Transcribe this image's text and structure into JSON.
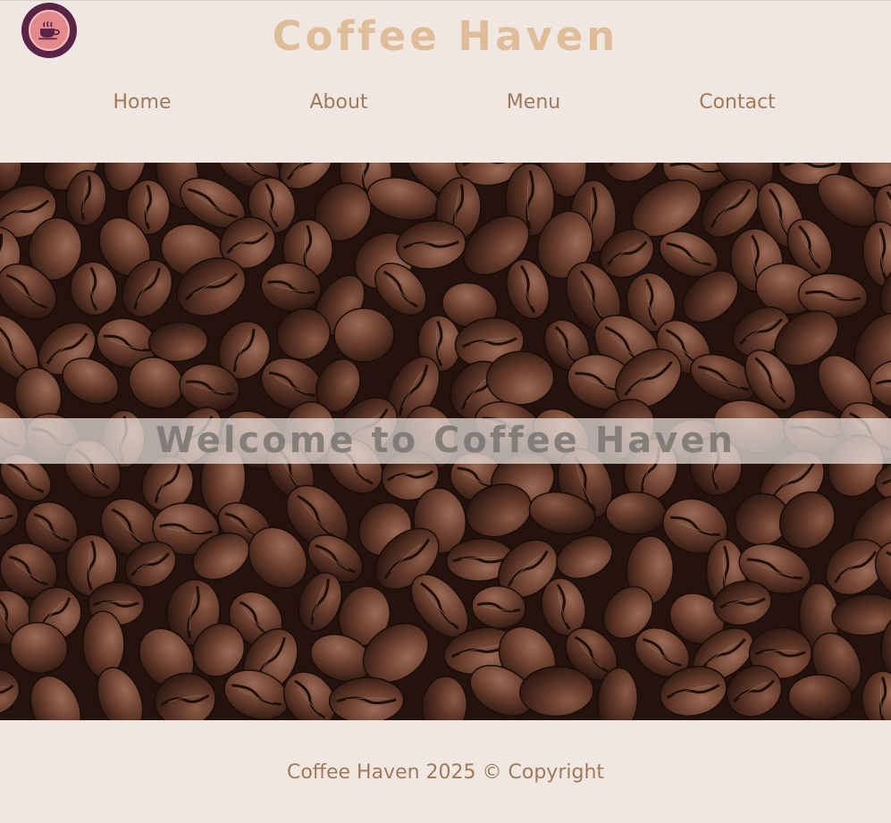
{
  "header": {
    "logo_icon": "coffee-cup-icon",
    "title": "Coffee Haven"
  },
  "nav": {
    "items": [
      {
        "label": "Home"
      },
      {
        "label": "About"
      },
      {
        "label": "Menu"
      },
      {
        "label": "Contact"
      }
    ]
  },
  "hero": {
    "image": "coffee-beans-photo",
    "banner_text": "Welcome to Coffee Haven"
  },
  "footer": {
    "copyright": "Coffee Haven 2025 © Copyright"
  },
  "colors": {
    "background": "#f0e7e3",
    "title": "#dfbd98",
    "nav_link": "#a07a56",
    "logo_outer": "#5a2444",
    "logo_inner": "#e48a8c"
  }
}
